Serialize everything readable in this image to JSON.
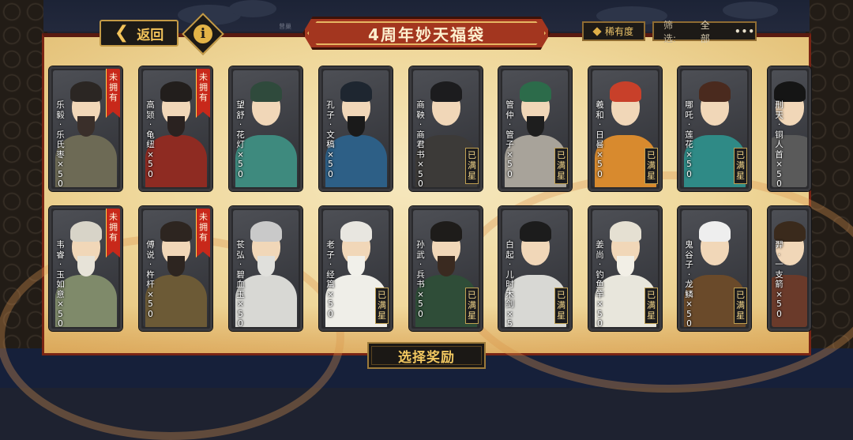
{
  "header": {
    "back_label": "返回",
    "info_label": "i",
    "small_label": "曾巢",
    "title": "4周年妙天福袋",
    "rarity_label": "稀有度",
    "filter_label": "筛选:",
    "filter_value": "全部",
    "more_label": "•••"
  },
  "cards_row1": [
    {
      "name": "乐毅·乐氏枣×50",
      "unowned": "未拥有",
      "full": "",
      "hair": "#2b2623",
      "body": "#6d6a55",
      "beard": "#3a2f2a"
    },
    {
      "name": "高颎·龟纽×50",
      "unowned": "未拥有",
      "full": "",
      "hair": "#221e1c",
      "body": "#8e2b22",
      "beard": "#2a2220"
    },
    {
      "name": "望舒·花灯×50",
      "unowned": "",
      "full": "",
      "hair": "#2f4a3c",
      "body": "#3e8a7e",
      "beard": ""
    },
    {
      "name": "孔子·文稿×50",
      "unowned": "",
      "full": "",
      "hair": "#1e2630",
      "body": "#2d5f86",
      "beard": "#1a1a1a"
    },
    {
      "name": "商鞅·商君书×50",
      "unowned": "",
      "full": "已满星",
      "hair": "#1c1c1e",
      "body": "#3c3a38",
      "beard": ""
    },
    {
      "name": "管仲·管子×50",
      "unowned": "",
      "full": "已满星",
      "hair": "#2c6b4a",
      "body": "#a8a39a",
      "beard": "#1e1e1e"
    },
    {
      "name": "羲和·日晷×50",
      "unowned": "",
      "full": "已满星",
      "hair": "#c8402a",
      "body": "#d88a2e",
      "beard": ""
    },
    {
      "name": "哪吒·莲花×50",
      "unowned": "",
      "full": "已满星",
      "hair": "#4a2a1e",
      "body": "#2f8a86",
      "beard": ""
    },
    {
      "name": "刑天·铜人首×50",
      "unowned": "",
      "full": "",
      "hair": "#151515",
      "body": "#5a5a5a",
      "beard": ""
    }
  ],
  "cards_row2": [
    {
      "name": "韦睿·玉如意×50",
      "unowned": "未拥有",
      "full": "",
      "hair": "#d8d4c8",
      "body": "#7f8a6a",
      "beard": "#e7e3d8"
    },
    {
      "name": "傅说·杵杆×50",
      "unowned": "未拥有",
      "full": "",
      "hair": "#2d2520",
      "body": "#6c5a36",
      "beard": "#2d2520"
    },
    {
      "name": "苌弘·碧血玉×50",
      "unowned": "",
      "full": "",
      "hair": "#c9c9c9",
      "body": "#d8d8d4",
      "beard": "#e0e0dc"
    },
    {
      "name": "老子·经篇×50",
      "unowned": "",
      "full": "已满星",
      "hair": "#e8e6e0",
      "body": "#efeee8",
      "beard": "#f1f0ea"
    },
    {
      "name": "孙武·兵书×50",
      "unowned": "",
      "full": "已满星",
      "hair": "#1e1c1a",
      "body": "#2f4d38",
      "beard": "#3a2a20"
    },
    {
      "name": "白起·儿时木剑×50",
      "unowned": "",
      "full": "已满星",
      "hair": "#1c1c1c",
      "body": "#d8d8d4",
      "beard": ""
    },
    {
      "name": "姜尚·钓鱼竿×50",
      "unowned": "",
      "full": "已满星",
      "hair": "#e5e0d2",
      "body": "#e8e6dc",
      "beard": "#f2efe6"
    },
    {
      "name": "鬼谷子·龙鳞×50",
      "unowned": "",
      "full": "已满星",
      "hair": "#eeeeee",
      "body": "#6a4a2a",
      "beard": ""
    },
    {
      "name": "羿·一支箭×50",
      "unowned": "",
      "full": "",
      "hair": "#3a2a1c",
      "body": "#6a3a2a",
      "beard": ""
    }
  ],
  "footer": {
    "select_label": "选择奖励"
  }
}
